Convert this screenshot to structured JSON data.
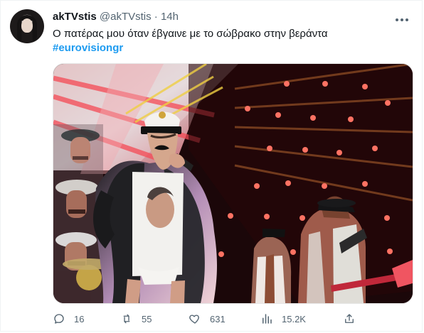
{
  "tweet": {
    "display_name": "akTVstis",
    "handle": "@akTVstis",
    "separator": "·",
    "time": "14h",
    "text": "Ο πατέρας μου όταν έβγαινε με το σώβρακο στην βεράντα",
    "hashtag": "#eurovisiongr",
    "more_icon": "more-icon"
  },
  "actions": {
    "reply_count": "16",
    "retweet_count": "55",
    "like_count": "631",
    "views_count": "15.2K",
    "icons": [
      "reply-icon",
      "retweet-icon",
      "like-icon",
      "views-icon",
      "share-icon"
    ]
  },
  "colors": {
    "text": "#0f1419",
    "secondary": "#536471",
    "link": "#1d9bf0"
  }
}
